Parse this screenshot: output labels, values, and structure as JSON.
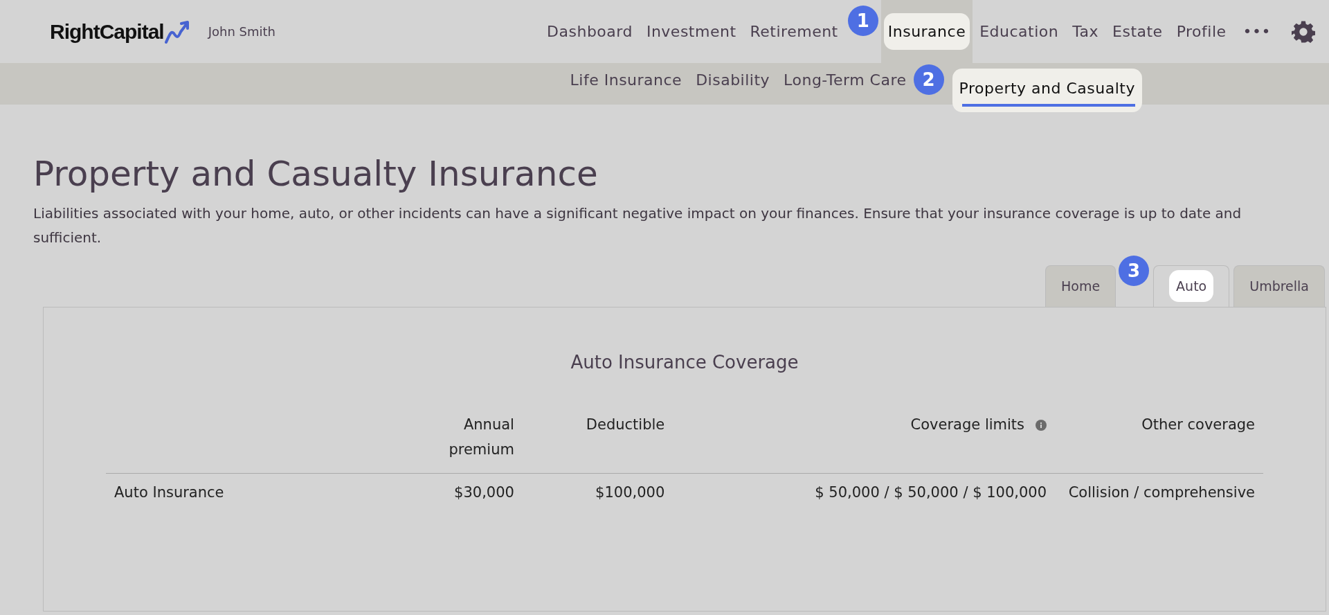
{
  "brand": {
    "name": "RightCapital",
    "user": "John Smith"
  },
  "nav": [
    {
      "label": "Dashboard",
      "selected": false
    },
    {
      "label": "Investment",
      "selected": false
    },
    {
      "label": "Retirement",
      "selected": false
    },
    {
      "label": "Insurance",
      "selected": true,
      "callout": "1"
    },
    {
      "label": "Education",
      "selected": false
    },
    {
      "label": "Tax",
      "selected": false
    },
    {
      "label": "Estate",
      "selected": false
    },
    {
      "label": "Profile",
      "selected": false
    }
  ],
  "more": "•••",
  "subnav": [
    {
      "label": "Life Insurance",
      "selected": false
    },
    {
      "label": "Disability",
      "selected": false
    },
    {
      "label": "Long-Term Care",
      "selected": false
    },
    {
      "label": "Property and Casualty",
      "selected": true,
      "callout": "2"
    }
  ],
  "page": {
    "title": "Property and Casualty Insurance",
    "description": "Liabilities associated with your home, auto, or other incidents can have a significant negative impact on your finances. Ensure that your insurance coverage is up to date and sufficient."
  },
  "tabs": [
    {
      "label": "Home",
      "selected": false
    },
    {
      "label": "Auto",
      "selected": true,
      "callout": "3"
    },
    {
      "label": "Umbrella",
      "selected": false
    }
  ],
  "card": {
    "title": "Auto Insurance Coverage",
    "columns": [
      {},
      {
        "label": "Annual premium"
      },
      {
        "label": "Deductible"
      },
      {
        "label": "Coverage limits",
        "info": true
      },
      {
        "label": "Other coverage"
      }
    ],
    "rows": [
      [
        "Auto Insurance",
        "$30,000",
        "$100,000",
        "$ 50,000 / $ 50,000 / $ 100,000",
        "Collision / comprehensive"
      ]
    ]
  }
}
